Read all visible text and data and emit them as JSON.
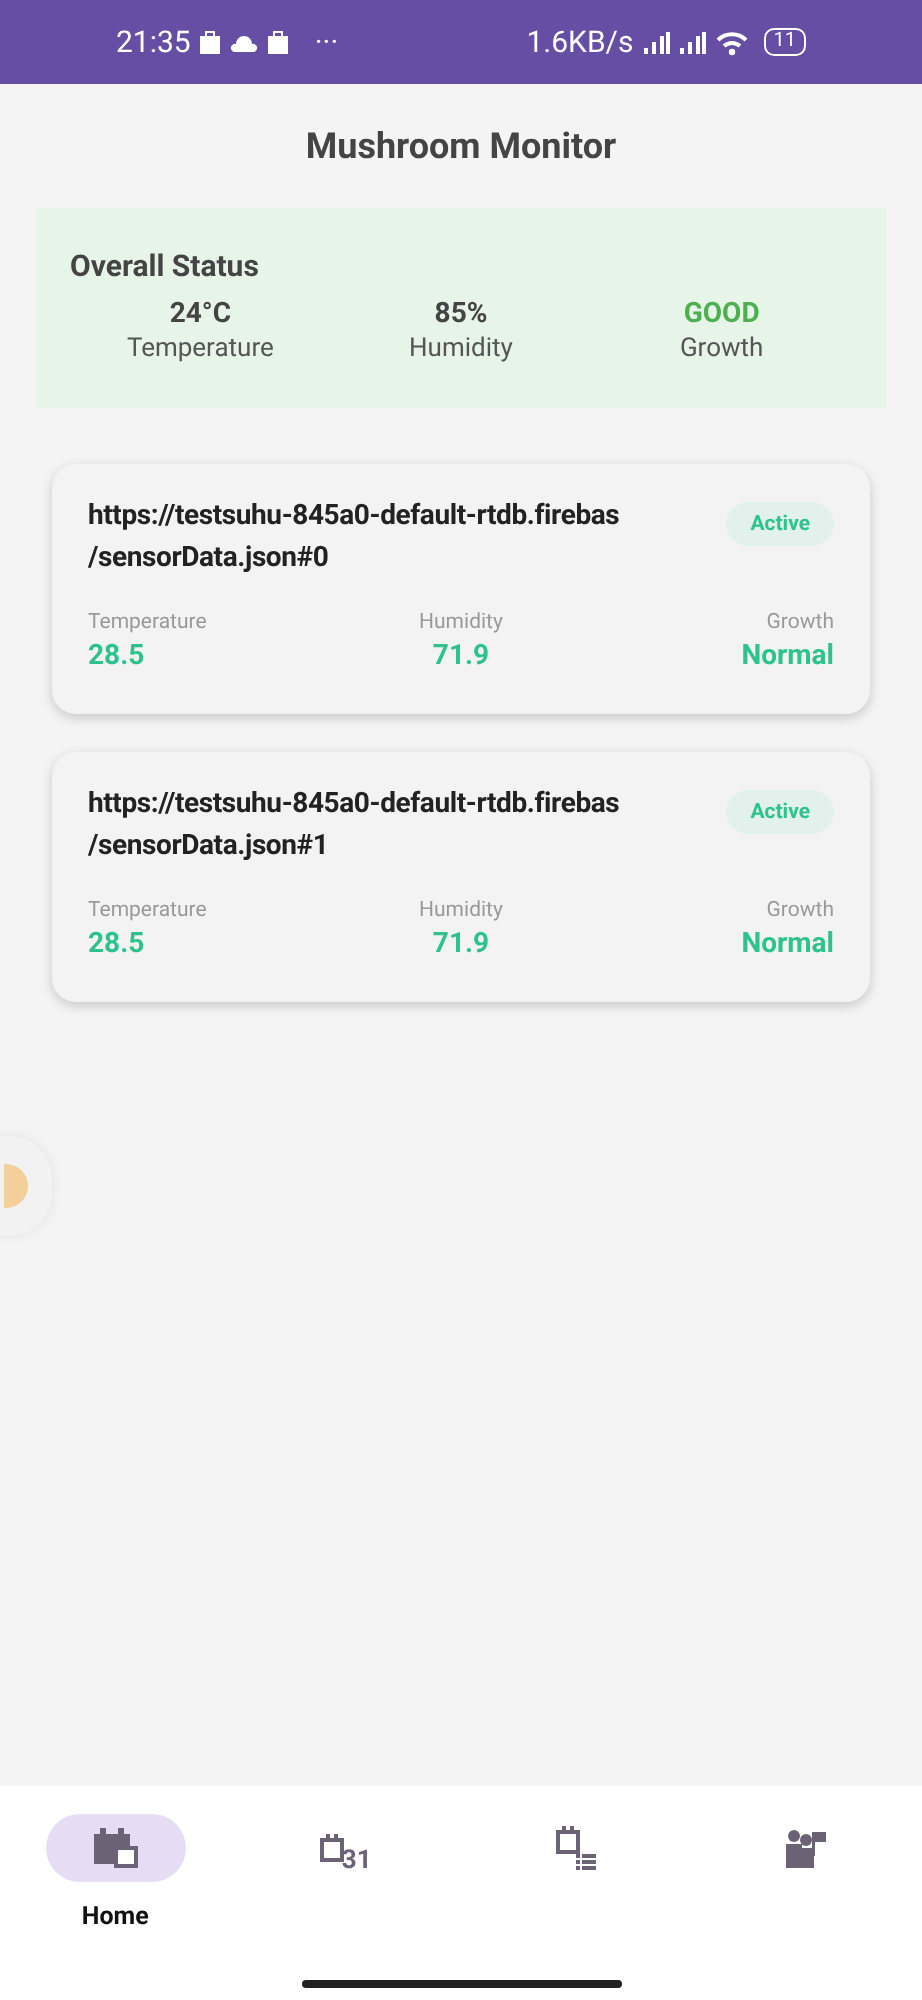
{
  "status_bar": {
    "time": "21:35",
    "more": "···",
    "speed": "1.6KB/s",
    "battery": "11"
  },
  "title": "Mushroom Monitor",
  "overall": {
    "heading": "Overall Status",
    "stats": [
      {
        "value": "24°C",
        "label": "Temperature",
        "color": "#444444"
      },
      {
        "value": "85%",
        "label": "Humidity",
        "color": "#444444"
      },
      {
        "value": "GOOD",
        "label": "Growth",
        "color": "#4caf50"
      }
    ]
  },
  "sensors": [
    {
      "url": "https://testsuhu-845a0-default-rtdb.firebas",
      "path": "/sensorData.json#0",
      "badge": "Active",
      "readings": [
        {
          "label": "Temperature",
          "value": "28.5"
        },
        {
          "label": "Humidity",
          "value": "71.9"
        },
        {
          "label": "Growth",
          "value": "Normal"
        }
      ]
    },
    {
      "url": "https://testsuhu-845a0-default-rtdb.firebas",
      "path": "/sensorData.json#1",
      "badge": "Active",
      "readings": [
        {
          "label": "Temperature",
          "value": "28.5"
        },
        {
          "label": "Humidity",
          "value": "71.9"
        },
        {
          "label": "Growth",
          "value": "Normal"
        }
      ]
    }
  ],
  "nav": [
    {
      "kind": "home",
      "label": "Home",
      "selected": true
    },
    {
      "kind": "calendar",
      "badge": "31",
      "selected": false
    },
    {
      "kind": "schedule",
      "selected": false
    },
    {
      "kind": "people",
      "selected": false
    }
  ]
}
